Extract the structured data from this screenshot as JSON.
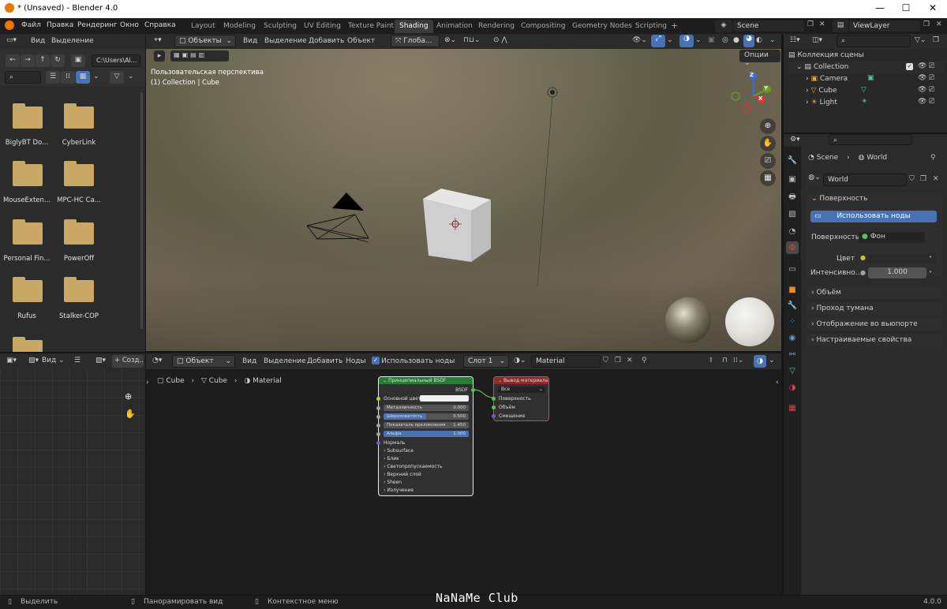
{
  "window": {
    "title": "* (Unsaved) - Blender 4.0",
    "minimize": "—",
    "maximize": "☐",
    "close": "✕"
  },
  "menu": [
    "Файл",
    "Правка",
    "Рендеринг",
    "Окно",
    "Справка"
  ],
  "workspaces": {
    "tabs": [
      "Layout",
      "Modeling",
      "Sculpting",
      "UV Editing",
      "Texture Paint",
      "Shading",
      "Animation",
      "Rendering",
      "Compositing",
      "Geometry Nodes",
      "Scripting"
    ],
    "active": "Shading",
    "add": "+"
  },
  "scene": {
    "name": "Scene",
    "view_layer": "ViewLayer"
  },
  "file_browser": {
    "menu": [
      "Вид",
      "Выделение"
    ],
    "path": "C:\\Users\\Al...",
    "items": [
      {
        "label": "BiglyBT Do..."
      },
      {
        "label": "CyberLink"
      },
      {
        "label": "MouseExten..."
      },
      {
        "label": "MPC-HC Ca..."
      },
      {
        "label": "Personal Fin..."
      },
      {
        "label": "PowerOff"
      },
      {
        "label": "Rufus"
      },
      {
        "label": "Stalker-COP"
      },
      {
        "label": ""
      }
    ]
  },
  "viewport": {
    "mode": "Объекты",
    "menu": [
      "Вид",
      "Выделение",
      "Добавить",
      "Объект"
    ],
    "transform": "Глоба...",
    "options": "Опции",
    "info_line1": "Пользовательская перспектива",
    "info_line2": "(1) Collection | Cube",
    "gizmo": {
      "z": "Z",
      "y": "Y",
      "x": "X"
    }
  },
  "image_editor": {
    "view": "Вид",
    "create": "+ Созд..."
  },
  "node_editor": {
    "mode": "Объект",
    "menu": [
      "Вид",
      "Выделение",
      "Добавить",
      "Ноды"
    ],
    "use_nodes": "Использовать ноды",
    "slot": "Слот 1",
    "material": "Material",
    "breadcrumb": [
      "Cube",
      "Cube",
      "Material"
    ],
    "bsdf_node": {
      "title": "Принципиальный BSDF",
      "output": "BSDF",
      "base_color": "Основной цвет",
      "rows": [
        {
          "label": "Металличность",
          "value": "0.000",
          "fill": 0.0
        },
        {
          "label": "Шероховатость",
          "value": "0.500",
          "fill": 0.5
        },
        {
          "label": "Показатель преломления",
          "value": "1.450",
          "fill": 0.0
        },
        {
          "label": "Альфа",
          "value": "1.000",
          "fill": 1.0
        }
      ],
      "normal": "Нормаль",
      "panels": [
        "Subsurface",
        "Блик",
        "Светопропускаемость",
        "Верхний слой",
        "Sheen",
        "Излучение"
      ]
    },
    "output_node": {
      "title": "Вывод материала",
      "target": "Все",
      "inputs": [
        "Поверхность",
        "Объём",
        "Смещение"
      ]
    }
  },
  "outliner": {
    "root": "Коллекция сцены",
    "collection": "Collection",
    "items": [
      "Camera",
      "Cube",
      "Light"
    ]
  },
  "properties": {
    "breadcrumb": [
      "Scene",
      "World"
    ],
    "world_name": "World",
    "surface_section": "Поверхность",
    "use_nodes_button": "Использовать ноды",
    "surface_label": "Поверхность",
    "surface_value": "Фон",
    "color_label": "Цвет",
    "strength_label": "Интенсивно...",
    "strength_value": "1.000",
    "sections": [
      "Объём",
      "Проход тумана",
      "Отображение во вьюпорте",
      "Настраиваемые свойства"
    ]
  },
  "status": {
    "select": "Выделить",
    "pan": "Панорамировать вид",
    "context": "Контекстное меню",
    "watermark": "NaNaMe Club",
    "version": "4.0.0"
  },
  "colors": {
    "accent": "#4772b3",
    "bsdf_header": "#2a7a3a",
    "output_header": "#8a2a2a",
    "folder": "#c8a864"
  }
}
